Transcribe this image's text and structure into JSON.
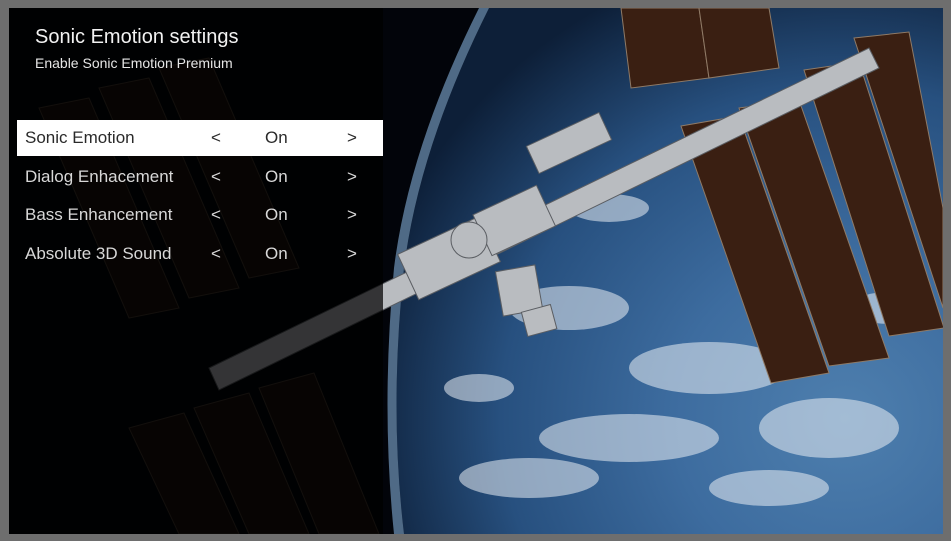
{
  "header": {
    "title": "Sonic Emotion settings",
    "subtitle": "Enable Sonic Emotion Premium"
  },
  "menu": {
    "items": [
      {
        "label": "Sonic Emotion",
        "left_arrow": "<",
        "value": "On",
        "right_arrow": ">",
        "selected": true
      },
      {
        "label": "Dialog Enhacement",
        "left_arrow": "<",
        "value": "On",
        "right_arrow": ">",
        "selected": false
      },
      {
        "label": "Bass Enhancement",
        "left_arrow": "<",
        "value": "On",
        "right_arrow": ">",
        "selected": false
      },
      {
        "label": "Absolute 3D Sound",
        "left_arrow": "<",
        "value": "On",
        "right_arrow": ">",
        "selected": false
      }
    ]
  },
  "background": {
    "image": "space-station-earth-photo"
  },
  "colors": {
    "selected_bg": "#ffffff",
    "selected_text": "#2a2a2a",
    "text": "#d8d8d8"
  }
}
